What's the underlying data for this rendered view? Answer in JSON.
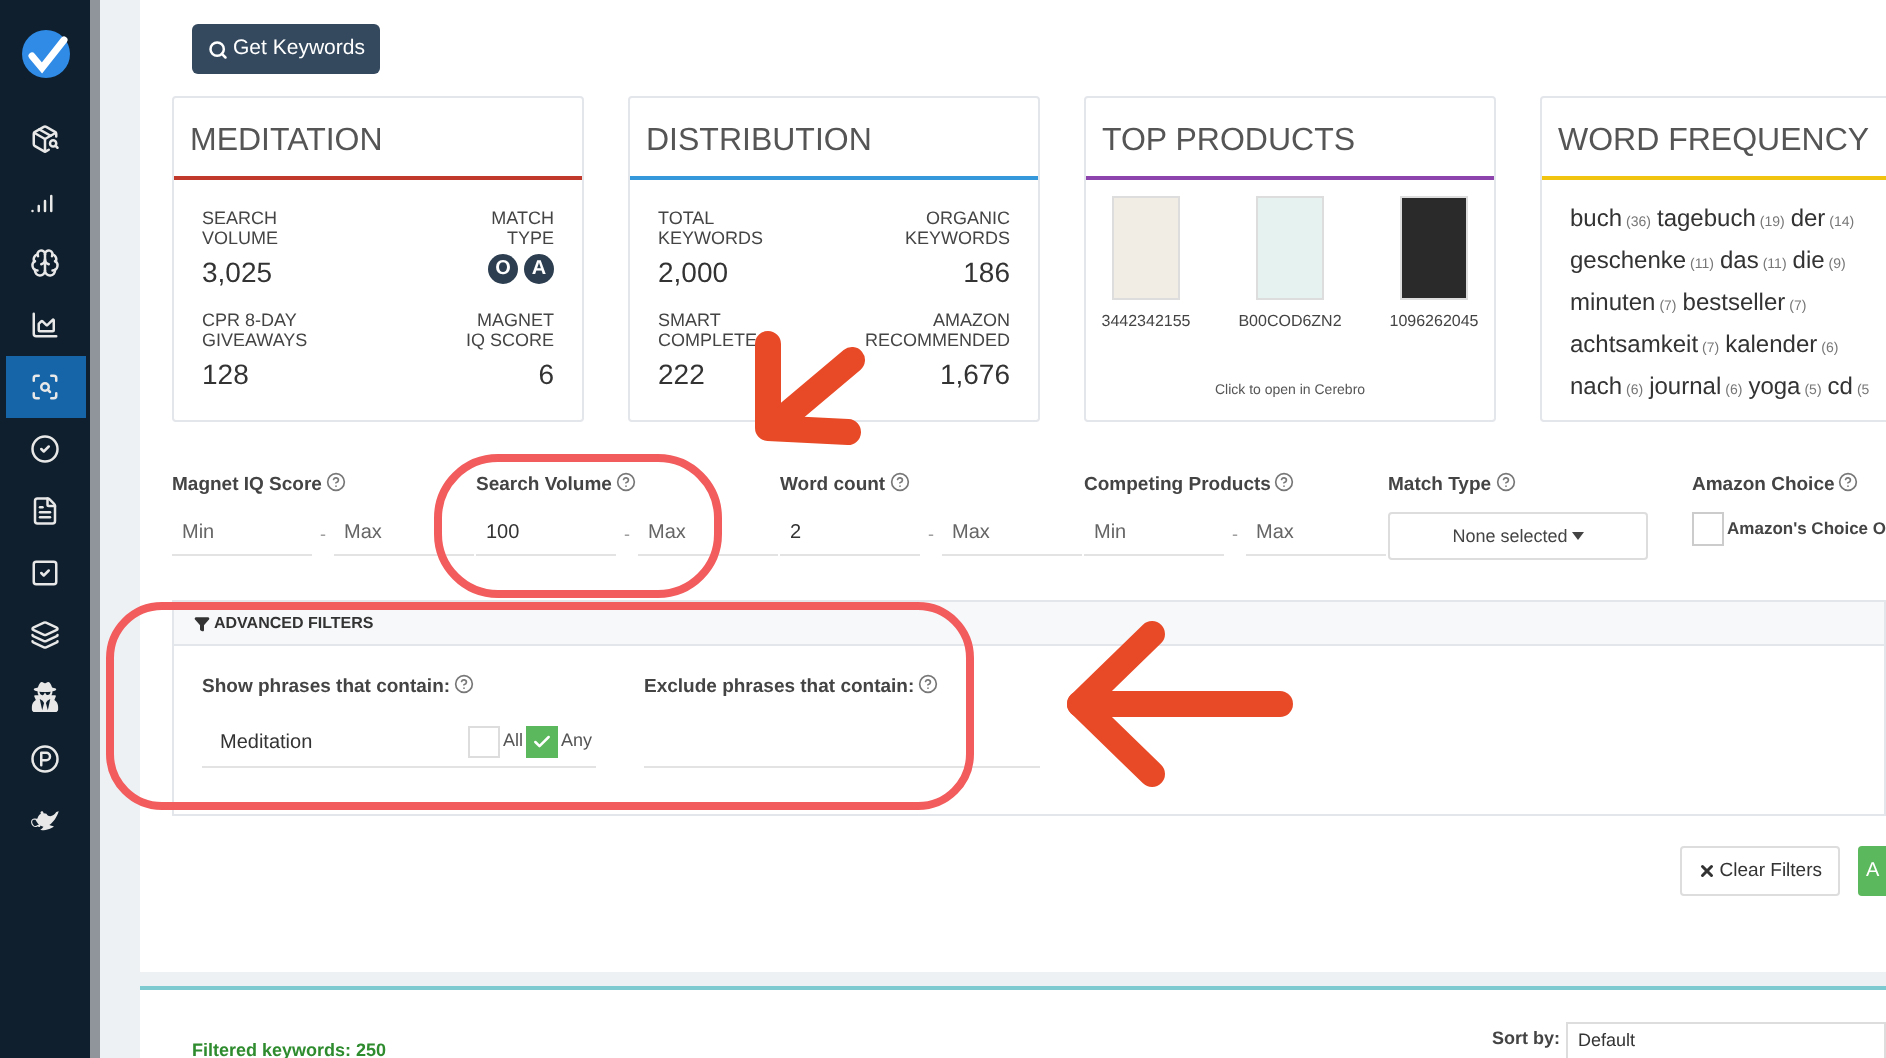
{
  "sidebar": {
    "items": [
      {
        "selected": false
      },
      {
        "selected": false
      },
      {
        "selected": false
      },
      {
        "selected": false
      },
      {
        "selected": true
      },
      {
        "selected": false
      },
      {
        "selected": false
      },
      {
        "selected": false
      },
      {
        "selected": false
      },
      {
        "selected": false
      },
      {
        "selected": false
      },
      {
        "selected": false
      }
    ]
  },
  "get_keywords_button": "Get Keywords",
  "cards": [
    {
      "kind": "stats",
      "title": "MEDITATION",
      "color": "#c0392b",
      "stats": [
        {
          "label": "SEARCH\nVOLUME",
          "value": "3,025"
        },
        {
          "label": "MATCH\nTYPE",
          "badges": [
            "O",
            "A"
          ]
        },
        {
          "label": "CPR 8-DAY\nGIVEAWAYS",
          "value": "128"
        },
        {
          "label": "MAGNET\nIQ SCORE",
          "value": "6"
        }
      ]
    },
    {
      "kind": "stats",
      "title": "DISTRIBUTION",
      "color": "#3498db",
      "stats": [
        {
          "label": "TOTAL\nKEYWORDS",
          "value": "2,000"
        },
        {
          "label": "ORGANIC\nKEYWORDS",
          "value": "186"
        },
        {
          "label": "SMART\nCOMPLETE",
          "value": "222"
        },
        {
          "label": "AMAZON\nRECOMMENDED",
          "value": "1,676"
        }
      ]
    },
    {
      "kind": "products",
      "title": "TOP PRODUCTS",
      "color": "#8e44ad",
      "products": [
        "3442342155",
        "B00COD6ZN2",
        "1096262045"
      ],
      "caption": "Click to open in Cerebro"
    },
    {
      "kind": "words",
      "title": "WORD FREQUENCY",
      "color": "#f1c40f",
      "words": [
        {
          "word": "buch",
          "count": "(36)"
        },
        {
          "word": "tagebuch",
          "count": "(19)"
        },
        {
          "word": "der",
          "count": "(14)"
        },
        {
          "word": "geschenke",
          "count": "(11)"
        },
        {
          "word": "das",
          "count": "(11)"
        },
        {
          "word": "die",
          "count": "(9)"
        },
        {
          "word": "minuten",
          "count": "(7)"
        },
        {
          "word": "bestseller",
          "count": "(7)"
        },
        {
          "word": "achtsamkeit",
          "count": "(7)"
        },
        {
          "word": "kalender",
          "count": "(6)"
        },
        {
          "word": "nach",
          "count": "(6)"
        },
        {
          "word": "journal",
          "count": "(6)"
        },
        {
          "word": "yoga",
          "count": "(5)"
        },
        {
          "word": "cd",
          "count": "(5"
        }
      ]
    }
  ],
  "filters": [
    {
      "kind": "range",
      "label": "Magnet IQ Score",
      "min_placeholder": "Min",
      "separator": "-",
      "max_placeholder": "Max"
    },
    {
      "kind": "range",
      "label": "Search Volume",
      "min_value": "100",
      "separator": "-",
      "max_placeholder": "Max"
    },
    {
      "kind": "range",
      "label": "Word count",
      "min_value": "2",
      "separator": "-",
      "max_placeholder": "Max"
    },
    {
      "kind": "range",
      "label": "Competing Products",
      "min_placeholder": "Min",
      "separator": "-",
      "max_placeholder": "Max"
    },
    {
      "kind": "select",
      "label": "Match Type",
      "value": "None selected"
    },
    {
      "kind": "checkbox",
      "label": "Amazon Choice",
      "option": "Amazon's Choice O",
      "checked": false
    }
  ],
  "advanced_filters": {
    "title": "ADVANCED FILTERS",
    "expanded": true,
    "show_label": "Show phrases that contain:",
    "show_value": "Meditation",
    "options": [
      {
        "label": "All",
        "checked": false
      },
      {
        "label": "Any",
        "checked": true
      }
    ],
    "exclude_label": "Exclude phrases that contain:"
  },
  "clear_filters_button": "Clear Filters",
  "apply_button": "A",
  "results": {
    "count": "Filtered keywords: 250",
    "sort_label": "Sort by:",
    "sort_value": "Default"
  }
}
